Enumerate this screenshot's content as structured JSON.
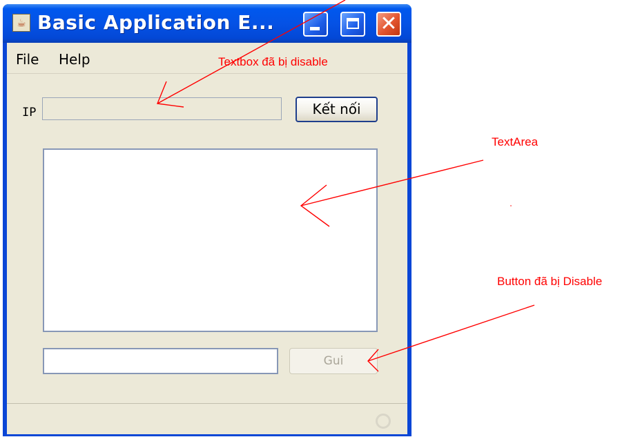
{
  "window": {
    "title": "Basic Application E..."
  },
  "menu": {
    "items": [
      "File",
      "Help"
    ]
  },
  "form": {
    "ip_label": "IP",
    "ip_value": "",
    "connect_label": "Kết nối",
    "textarea_value": "",
    "message_value": "",
    "send_label": "Gui"
  },
  "annotations": {
    "textbox_disabled": "Textbox đã bị disable",
    "textarea": "TextArea",
    "button_disabled": "Button đã bị Disable"
  },
  "colors": {
    "annotation": "#ff0000",
    "titlebar": "#0552e5",
    "client_bg": "#ece9d8"
  }
}
